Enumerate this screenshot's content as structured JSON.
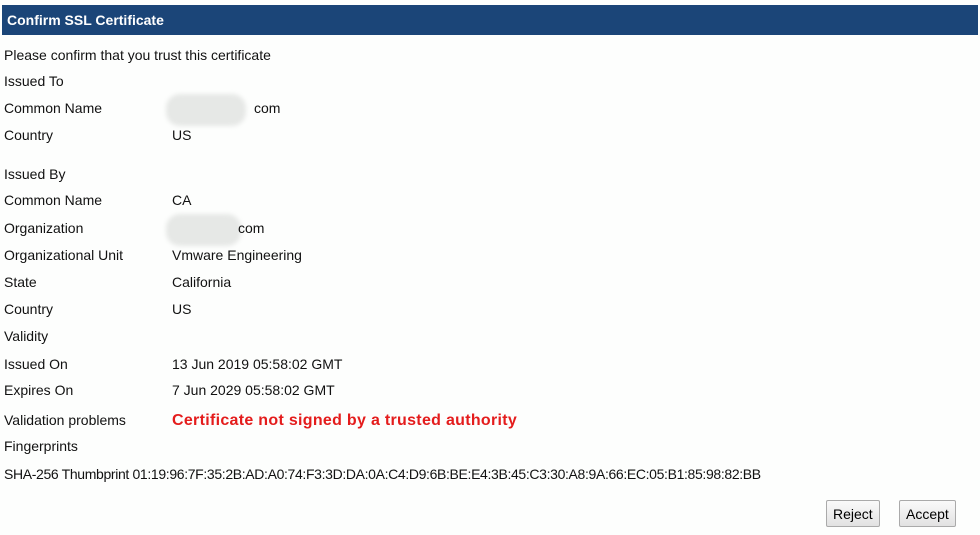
{
  "title": "Confirm SSL Certificate",
  "prompt": "Please confirm that you trust this certificate",
  "issued_to": {
    "heading": "Issued To",
    "rows": [
      {
        "label": "Common Name",
        "value": "com"
      },
      {
        "label": "Country",
        "value": "US"
      }
    ]
  },
  "issued_by": {
    "heading": "Issued By",
    "rows": [
      {
        "label": "Common Name",
        "value": "CA"
      },
      {
        "label": "Organization",
        "value": "com"
      },
      {
        "label": "Organizational Unit",
        "value": "Vmware Engineering"
      },
      {
        "label": "State",
        "value": "California"
      },
      {
        "label": "Country",
        "value": "US"
      }
    ]
  },
  "validity": {
    "heading": "Validity",
    "rows": [
      {
        "label": "Issued On",
        "value": "13 Jun 2019 05:58:02 GMT"
      },
      {
        "label": "Expires On",
        "value": "7 Jun 2029 05:58:02 GMT"
      }
    ]
  },
  "validation": {
    "label": "Validation problems",
    "value": "Certificate not signed by a trusted authority",
    "color": "#e41c1c"
  },
  "fingerprints": {
    "heading": "Fingerprints",
    "label": "SHA-256 Thumbprint",
    "value": "01:19:96:7F:35:2B:AD:A0:74:F3:3D:DA:0A:C4:D9:6B:BE:E4:3B:45:C3:30:A8:9A:66:EC:05:B1:85:98:82:BB"
  },
  "buttons": {
    "reject": "Reject",
    "accept": "Accept"
  }
}
